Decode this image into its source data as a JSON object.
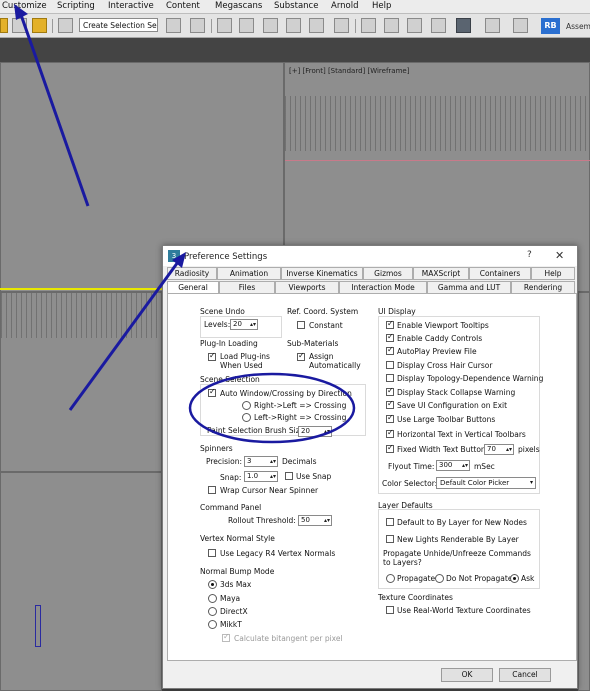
{
  "menubar": {
    "items": [
      "Customize",
      "Scripting",
      "Interactive",
      "Content",
      "Megascans",
      "Substance",
      "Arnold",
      "Help"
    ]
  },
  "toolbar": {
    "selection_set_value": "Create Selection Se",
    "rb_logo": "RB",
    "assembly_text": "Assem"
  },
  "viewport": {
    "front_label": "[+] [Front] [Standard] [Wireframe]"
  },
  "dialog": {
    "title": "Preference Settings",
    "help": "?",
    "close": "✕",
    "tabs_row1": [
      "Radiosity",
      "Animation",
      "Inverse Kinematics",
      "Gizmos",
      "MAXScript",
      "Containers",
      "Help"
    ],
    "tabs_row2": [
      "General",
      "Files",
      "Viewports",
      "Interaction Mode",
      "Gamma and LUT",
      "Rendering"
    ],
    "scene_undo": {
      "title": "Scene Undo",
      "levels_label": "Levels:",
      "levels_value": "20"
    },
    "ref_coord": {
      "title": "Ref. Coord. System",
      "constant": "Constant"
    },
    "plugin_loading": {
      "title": "Plug-In Loading",
      "load_label": "Load Plug-ins\nWhen Used"
    },
    "sub_materials": {
      "title": "Sub-Materials",
      "assign_label": "Assign\nAutomatically"
    },
    "scene_selection": {
      "title": "Scene Selection",
      "auto_window": "Auto Window/Crossing by Direction",
      "right_left": "Right->Left => Crossing",
      "left_right": "Left->Right => Crossing",
      "paint_label": "Paint Selection Brush Size",
      "paint_value": "20"
    },
    "spinners": {
      "title": "Spinners",
      "precision_label": "Precision:",
      "precision_value": "3",
      "decimals": "Decimals",
      "snap_label": "Snap:",
      "snap_value": "1.0",
      "use_snap": "Use Snap",
      "wrap_cursor": "Wrap Cursor Near Spinner"
    },
    "command_panel": {
      "title": "Command Panel",
      "rollout_label": "Rollout Threshold:",
      "rollout_value": "50"
    },
    "vertex_normal": {
      "title": "Vertex Normal Style",
      "legacy": "Use Legacy R4 Vertex Normals"
    },
    "normal_bump": {
      "title": "Normal Bump Mode",
      "options": [
        "3ds Max",
        "Maya",
        "DirectX",
        "MikkT"
      ],
      "calc_bitangent": "Calculate bitangent per pixel"
    },
    "ui_display": {
      "title": "UI Display",
      "items": [
        "Enable Viewport Tooltips",
        "Enable Caddy Controls",
        "AutoPlay Preview File",
        "Display Cross Hair Cursor",
        "Display Topology-Dependence Warning",
        "Display Stack Collapse Warning",
        "Save UI Configuration on Exit",
        "Use Large Toolbar Buttons",
        "Horizontal Text in Vertical Toolbars",
        "Fixed Width Text Buttons:"
      ],
      "fixed_width_value": "70",
      "pixels": "pixels",
      "flyout_label": "Flyout Time:",
      "flyout_value": "300",
      "msec": "mSec",
      "color_selector_label": "Color Selector:",
      "color_selector_value": "Default Color Picker"
    },
    "layer_defaults": {
      "title": "Layer Defaults",
      "default_bylayer": "Default to By Layer for New Nodes",
      "new_lights": "New Lights Renderable By Layer",
      "propagate_q": "Propagate Unhide/Unfreeze Commands\nto Layers?",
      "propagate": "Propagate",
      "do_not_propagate": "Do Not Propagate",
      "ask": "Ask"
    },
    "texture_coords": {
      "title": "Texture Coordinates",
      "real_world": "Use Real-World Texture Coordinates"
    },
    "ok": "OK",
    "cancel": "Cancel"
  }
}
